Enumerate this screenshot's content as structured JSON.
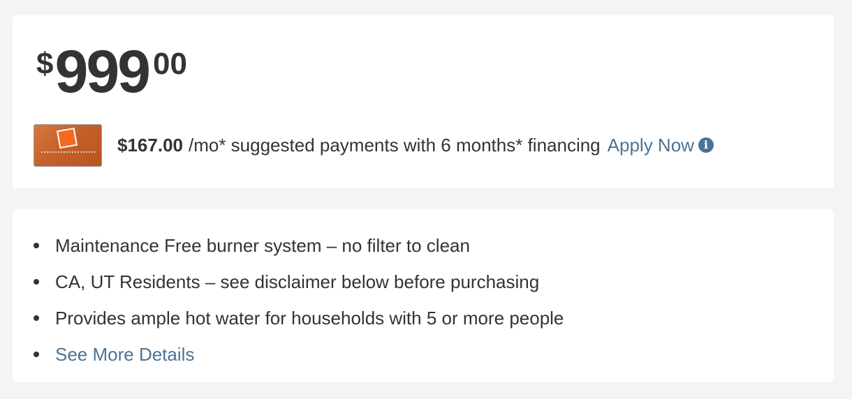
{
  "price": {
    "currency": "$",
    "dollars": "999",
    "cents": "00"
  },
  "financing": {
    "card_image_icon": "home-depot-credit-card-icon",
    "monthly_amount": "$167.00",
    "text": "/mo* suggested payments with 6 months* financing",
    "apply_label": "Apply Now",
    "info_icon": "i"
  },
  "highlights": {
    "items": [
      "Maintenance Free burner system – no filter to clean",
      "CA, UT Residents – see disclaimer below before purchasing",
      "Provides ample hot water for households with 5 or more people"
    ],
    "more_link": "See More Details"
  },
  "colors": {
    "link": "#4d7394",
    "text": "#333333",
    "background": "#f4f4f4",
    "card": "#ffffff"
  }
}
